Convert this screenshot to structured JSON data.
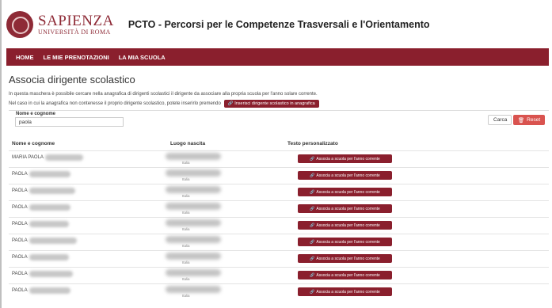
{
  "header": {
    "logo_main": "SAPIENZA",
    "logo_sub": "UNIVERSITÀ DI ROMA",
    "title": "PCTO - Percorsi per le Competenze Trasversali e l'Orientamento"
  },
  "nav": {
    "items": [
      "HOME",
      "LE MIE PRENOTAZIONI",
      "LA MIA SCUOLA"
    ]
  },
  "page": {
    "title": "Associa dirigente scolastico",
    "intro_line1": "In questa maschera è possibile cercare nella anagrafica di dirigenti scolastici il dirigente da associare alla propria scuola per l'anno solare corrente.",
    "intro_line2": "Nel caso in cui la anagrafica non contenesse il proprio dirigente scolastico, potete inserirlo premendo",
    "insert_button": "Inserisci dirigente scolastico in anagrafica"
  },
  "search": {
    "label": "Nome e cognome",
    "value": "paola",
    "cerca_label": "Carca",
    "reset_label": "Reset"
  },
  "table": {
    "headers": [
      "Nome e cognome",
      "Luogo nascita",
      "Testo personalizzato"
    ],
    "rows": [
      {
        "name": "MARIA PAOLA",
        "place": "Italia",
        "action": "Associa a scuola per l'anno corrente"
      },
      {
        "name": "PAOLA",
        "place": "Italia",
        "action": "Associa a scuola per l'anno corrente"
      },
      {
        "name": "PAOLA",
        "place": "Italia",
        "action": "Associa a scuola per l'anno corrente"
      },
      {
        "name": "PAOLA",
        "place": "Italia",
        "action": "Associa a scuola per l'anno corrente"
      },
      {
        "name": "PAOLA",
        "place": "Italia",
        "action": "Associa a scuola per l'anno corrente"
      },
      {
        "name": "PAOLA",
        "place": "Italia",
        "action": "Associa a scuola per l'anno corrente"
      },
      {
        "name": "PAOLA",
        "place": "Italia",
        "action": "Associa a scuola per l'anno corrente"
      },
      {
        "name": "PAOLA",
        "place": "Italia",
        "action": "Associa a scuola per l'anno corrente"
      },
      {
        "name": "PAOLA",
        "place": "Italia",
        "action": "Associa a scuola per l'anno corrente"
      }
    ]
  },
  "colors": {
    "brand": "#8a1f2d",
    "reset": "#d9534f"
  },
  "icons": {
    "link": "link-icon",
    "trash": "trash-icon"
  }
}
